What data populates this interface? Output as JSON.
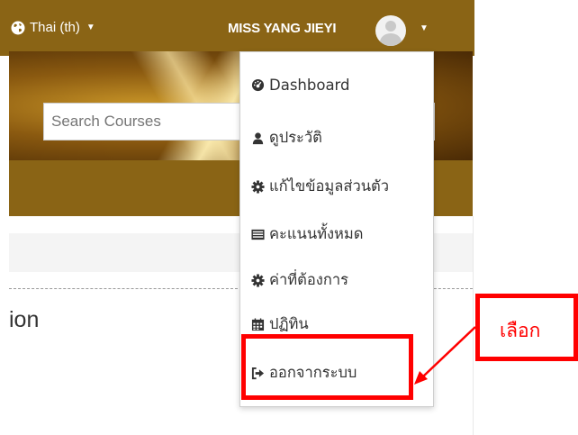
{
  "header": {
    "language_label": "Thai (th)",
    "user_name": "MISS YANG JIEYI"
  },
  "search": {
    "placeholder": "Search Courses"
  },
  "page": {
    "heading_fragment": "ion"
  },
  "user_menu": {
    "items": [
      {
        "label": "Dashboard",
        "icon": "dashboard-icon"
      },
      {
        "label": "ดูประวัติ",
        "icon": "user-icon"
      },
      {
        "label": "แก้ไขข้อมูลส่วนตัว",
        "icon": "cog-icon"
      },
      {
        "label": "คะแนนทั้งหมด",
        "icon": "grades-table-icon"
      },
      {
        "label": "ค่าที่ต้องการ",
        "icon": "cog-icon"
      },
      {
        "label": "ปฏิทิน",
        "icon": "calendar-icon"
      },
      {
        "label": "ออกจากระบบ",
        "icon": "sign-out-icon"
      }
    ]
  },
  "annotation": {
    "callout_text": "เลือก",
    "color": "#ff0000"
  },
  "colors": {
    "header_bg": "#8a6415",
    "menu_text": "#333333"
  }
}
